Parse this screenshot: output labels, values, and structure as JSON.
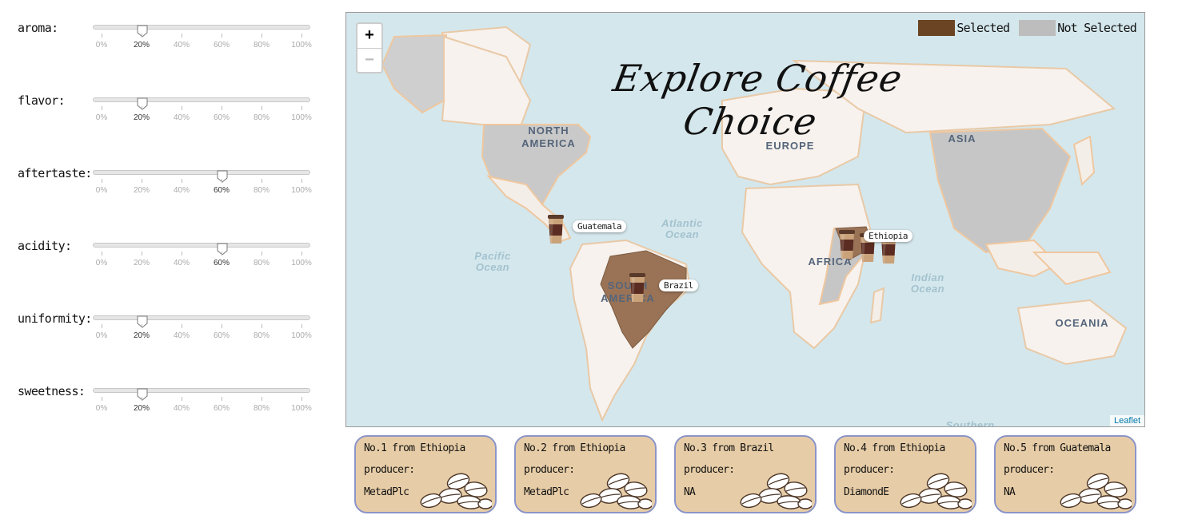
{
  "sliders": [
    {
      "label": "aroma:",
      "value": 20
    },
    {
      "label": "flavor:",
      "value": 20
    },
    {
      "label": "aftertaste:",
      "value": 60
    },
    {
      "label": "acidity:",
      "value": 60
    },
    {
      "label": "uniformity:",
      "value": 20
    },
    {
      "label": "sweetness:",
      "value": 20
    }
  ],
  "slider_ticks": [
    "0%",
    "20%",
    "40%",
    "60%",
    "80%",
    "100%"
  ],
  "map": {
    "title": "Explore Coffee Choice",
    "zoom_in": "+",
    "zoom_out": "−",
    "attribution": "Leaflet",
    "legend": [
      {
        "label": "Selected",
        "color": "#6b4423"
      },
      {
        "label": "Not Selected",
        "color": "#bdbdbd"
      }
    ],
    "regions": {
      "north_america": "NORTH\nAMERICA",
      "europe": "EUROPE",
      "asia": "ASIA",
      "africa": "AFRICA",
      "south_america": "SOUTH\nAMERICA",
      "oceania": "OCEANIA"
    },
    "oceans": {
      "atlantic": "Atlantic\nOcean",
      "pacific": "Pacific\nOcean",
      "indian": "Indian\nOcean",
      "southern": "Southern"
    },
    "markers": [
      {
        "label": "Guatemala"
      },
      {
        "label": "Brazil"
      },
      {
        "label": "Ethiopia"
      }
    ],
    "colors": {
      "ocean": "#d4e7ec",
      "land": "#f7f2ee",
      "selected": "#9a7356",
      "not_selected": "#bdbdbd"
    }
  },
  "cards": [
    {
      "title": "No.1 from Ethiopia",
      "producer_label": "producer:",
      "producer": "MetadPlc"
    },
    {
      "title": "No.2 from Ethiopia",
      "producer_label": "producer:",
      "producer": "MetadPlc"
    },
    {
      "title": "No.3 from Brazil",
      "producer_label": "producer:",
      "producer": "NA"
    },
    {
      "title": "No.4 from Ethiopia",
      "producer_label": "producer:",
      "producer": "DiamondE"
    },
    {
      "title": "No.5 from Guatemala",
      "producer_label": "producer:",
      "producer": "NA"
    }
  ]
}
